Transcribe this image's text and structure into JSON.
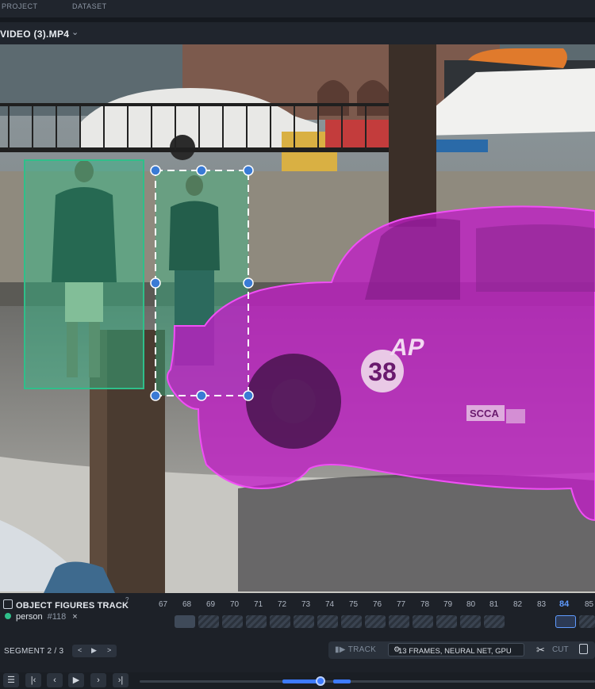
{
  "header": {
    "project_label": "PROJECT",
    "dataset_label": "DATASET"
  },
  "file": {
    "name": "VIDEO (3).MP4"
  },
  "annotations": {
    "car_label": "38",
    "car_text_ap": "AP",
    "car_text_scca": "SCCA"
  },
  "tracker": {
    "title": "OBJECT FIGURES TRACK",
    "help": "?",
    "frames": [
      "67",
      "68",
      "69",
      "70",
      "71",
      "72",
      "73",
      "74",
      "75",
      "76",
      "77",
      "78",
      "79",
      "80",
      "81",
      "82",
      "83",
      "84",
      "85"
    ],
    "current_frame": "84",
    "object": {
      "class": "person",
      "id": "#118",
      "remove": "×"
    }
  },
  "segment": {
    "label": "SEGMENT 2 / 3",
    "prev": "<",
    "play": "▶",
    "next": ">"
  },
  "track_tools": {
    "track_label": "TRACK",
    "settings": "13 FRAMES, NEURAL NET, GPU",
    "cut_label": "CUT"
  },
  "player": {
    "icons": [
      "settings-sliders-icon",
      "skip-start-icon",
      "step-back-icon",
      "play-icon",
      "step-forward-icon",
      "skip-end-icon"
    ]
  },
  "colors": {
    "accent": "#3d7bff",
    "person_box": "#2fbf8a",
    "car_mask": "#c21ec6"
  }
}
